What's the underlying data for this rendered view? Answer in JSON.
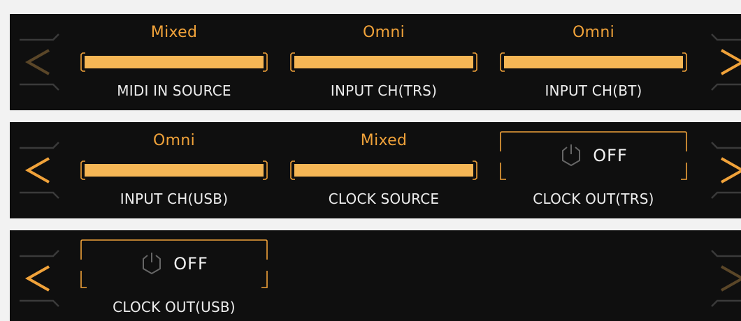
{
  "rows": [
    {
      "cells": [
        {
          "kind": "bar",
          "value": "Mixed",
          "label": "MIDI IN SOURCE"
        },
        {
          "kind": "bar",
          "value": "Omni",
          "label": "INPUT CH(TRS)"
        },
        {
          "kind": "bar",
          "value": "Omni",
          "label": "INPUT CH(BT)"
        }
      ],
      "nav": {
        "prev_enabled": false,
        "next_enabled": true
      }
    },
    {
      "cells": [
        {
          "kind": "bar",
          "value": "Omni",
          "label": "INPUT CH(USB)"
        },
        {
          "kind": "bar",
          "value": "Mixed",
          "label": "CLOCK SOURCE"
        },
        {
          "kind": "toggle",
          "state": "OFF",
          "label": "CLOCK OUT(TRS)",
          "icon": "power-icon"
        }
      ],
      "nav": {
        "prev_enabled": true,
        "next_enabled": true
      }
    },
    {
      "cells": [
        {
          "kind": "toggle",
          "state": "OFF",
          "label": "CLOCK OUT(USB)",
          "icon": "power-icon"
        }
      ],
      "nav": {
        "prev_enabled": true,
        "next_enabled": false
      }
    }
  ],
  "colors": {
    "accent": "#f0a23a",
    "bar_fill": "#f5b655",
    "panel_bg": "#0f0f0f",
    "page_bg": "#f2f2f2",
    "text": "#ececec",
    "dim": "#4a4030",
    "dim_gray": "#3c3c3c"
  },
  "icons": {
    "prev": "chevron-left-icon",
    "next": "chevron-right-icon",
    "toggle": "power-icon"
  }
}
